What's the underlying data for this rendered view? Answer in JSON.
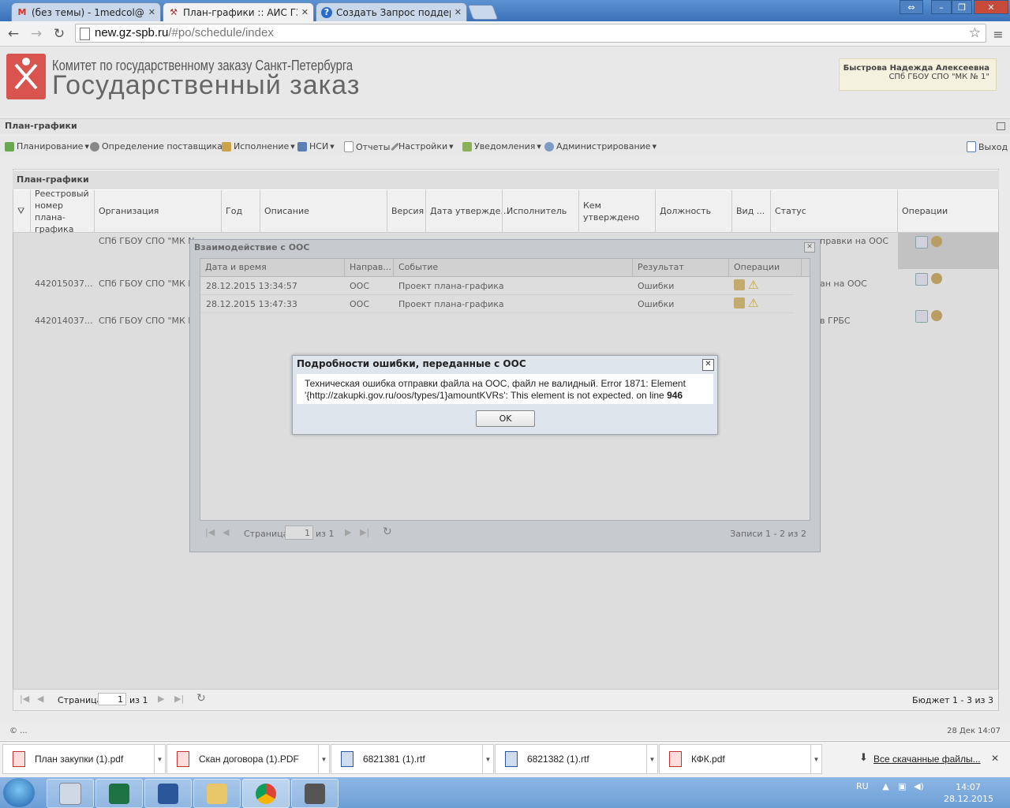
{
  "browser": {
    "tabs": [
      {
        "label": "(без темы) - 1medcol@gm",
        "icon": "gmail-icon",
        "active": false
      },
      {
        "label": "План-графики :: АИС ГЗ",
        "icon": "tools-icon",
        "active": true
      },
      {
        "label": "Создать Запрос поддерж",
        "icon": "help-icon",
        "active": false
      }
    ],
    "url_domain": "new.gz-spb.ru",
    "url_path": "/#po/schedule/index"
  },
  "header": {
    "committee": "Комитет по государственному заказу Санкт-Петербурга",
    "title": "Государственный заказ",
    "user_name": "Быстрова Надежда Алексеевна",
    "user_org": "СПб ГБОУ СПО \"МК № 1\""
  },
  "panel": {
    "title": "План-графики"
  },
  "menu": [
    {
      "label": "Планирование",
      "icon": "planning-icon",
      "color": "#6aa84f"
    },
    {
      "label": "Определение поставщика",
      "icon": "gear-icon",
      "color": "#888888"
    },
    {
      "label": "Исполнение",
      "icon": "execution-icon",
      "color": "#c9a24a"
    },
    {
      "label": "НСИ",
      "icon": "book-icon",
      "color": "#5b7fb3"
    },
    {
      "label": "Отчеты",
      "icon": "report-icon",
      "color": "#999999"
    },
    {
      "label": "Настройки",
      "icon": "wrench-icon",
      "color": "#8a8a8a"
    },
    {
      "label": "Уведомления",
      "icon": "notification-icon",
      "color": "#8bb05a"
    },
    {
      "label": "Администрирование",
      "icon": "user-icon",
      "color": "#7d9cc5"
    }
  ],
  "exit_label": "Выход",
  "grid": {
    "title": "План-графики",
    "columns": [
      "Реестровый номер плана-графика",
      "Организация",
      "Год",
      "Описание",
      "Версия",
      "Дата утвержде...",
      "Исполнитель",
      "Кем утверждено",
      "Должность",
      "Вид ...",
      "Статус",
      "Операции"
    ],
    "rows": [
      {
        "number": "",
        "org": "СПб ГБОУ СПО \"МК N",
        "status": "правки на ООС"
      },
      {
        "number": "442015037...",
        "org": "СПб ГБОУ СПО \"МК N",
        "status": "ан на ООС"
      },
      {
        "number": "442014037...",
        "org": "СПб ГБОУ СПО \"МК N",
        "status": "в ГРБС"
      }
    ],
    "pager": {
      "page_label": "Страница",
      "page": "1",
      "of": "из 1",
      "summary": "Бюджет 1 - 3 из 3"
    }
  },
  "ooc_window": {
    "title": "Взаимодействие с ООС",
    "columns": [
      "Дата и время",
      "Направ...",
      "Событие",
      "Результат",
      "Операции"
    ],
    "rows": [
      {
        "datetime": "28.12.2015 13:34:57",
        "direction": "ООС",
        "event": "Проект плана-графика",
        "result": "Ошибки"
      },
      {
        "datetime": "28.12.2015 13:47:33",
        "direction": "ООС",
        "event": "Проект плана-графика",
        "result": "Ошибки"
      }
    ],
    "pager": {
      "page_label": "Страница",
      "page": "1",
      "of": "из 1",
      "summary": "Записи 1 - 2 из 2"
    }
  },
  "error_dialog": {
    "title": "Подробности ошибки, переданные с ООС",
    "message_line1": "Техническая ошибка отправки файла на ООС, файл не валидный. Error 1871: Element",
    "message_line2": "'{http://zakupki.gov.ru/oos/types/1}amountKVRs': This element is not expected. on line ",
    "line_number": "946",
    "ok_label": "OK"
  },
  "status_bar": {
    "left": "© ...",
    "right": "28 Дек 14:07"
  },
  "downloads": [
    {
      "label": "План закупки (1).pdf",
      "type": "pdf"
    },
    {
      "label": "Скан договора (1).PDF",
      "type": "pdf"
    },
    {
      "label": "6821381 (1).rtf",
      "type": "doc"
    },
    {
      "label": "6821382 (1).rtf",
      "type": "doc"
    },
    {
      "label": "КФК.pdf",
      "type": "pdf"
    }
  ],
  "downloads_all": "Все скачанные файлы...",
  "taskbar": {
    "lang": "RU",
    "time": "14:07",
    "date": "28.12.2015",
    "apps": [
      "calculator-icon",
      "excel-icon",
      "word-icon",
      "explorer-icon",
      "chrome-icon",
      "printer-icon"
    ]
  }
}
